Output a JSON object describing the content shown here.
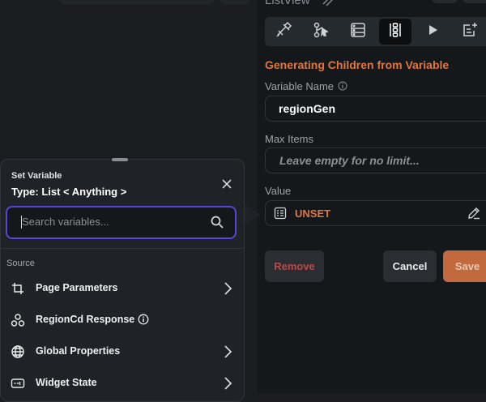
{
  "background_panel": {
    "title": "ListView",
    "section_title": "Generating Children from Variable",
    "variable_name": {
      "label": "Variable Name",
      "value": "regionGen"
    },
    "max_items": {
      "label": "Max Items",
      "placeholder": "Leave empty for no limit..."
    },
    "value": {
      "label": "Value",
      "current": "UNSET"
    },
    "buttons": {
      "remove": "Remove",
      "cancel": "Cancel",
      "save": "Save"
    },
    "tabs": [
      {
        "icon": "paint-tool-icon",
        "active": false
      },
      {
        "icon": "cursor-action-icon",
        "active": false
      },
      {
        "icon": "backend-query-icon",
        "active": false
      },
      {
        "icon": "generate-children-icon",
        "active": true
      },
      {
        "icon": "play-icon",
        "active": false
      },
      {
        "icon": "notes-icon",
        "active": false
      }
    ]
  },
  "popup": {
    "subtitle": "Set Variable",
    "title": "Type: List < Anything >",
    "search_placeholder": "Search variables...",
    "source_label": "Source",
    "sources": [
      {
        "label": "Page Parameters",
        "icon": "page-parameters-icon",
        "has_chevron": true,
        "has_info": false
      },
      {
        "label": "RegionCd Response",
        "icon": "api-response-icon",
        "has_chevron": false,
        "has_info": true
      },
      {
        "label": "Global Properties",
        "icon": "globe-icon",
        "has_chevron": true,
        "has_info": false
      },
      {
        "label": "Widget State",
        "icon": "widget-state-icon",
        "has_chevron": true,
        "has_info": false
      }
    ]
  },
  "colors": {
    "accent_orange": "#e0773f",
    "focus_purple": "#5a45d6",
    "remove_red": "#b84a4a",
    "save_orange": "#c26a3d",
    "panel_dark": "#14181b",
    "popup_bg": "#1f2327"
  }
}
